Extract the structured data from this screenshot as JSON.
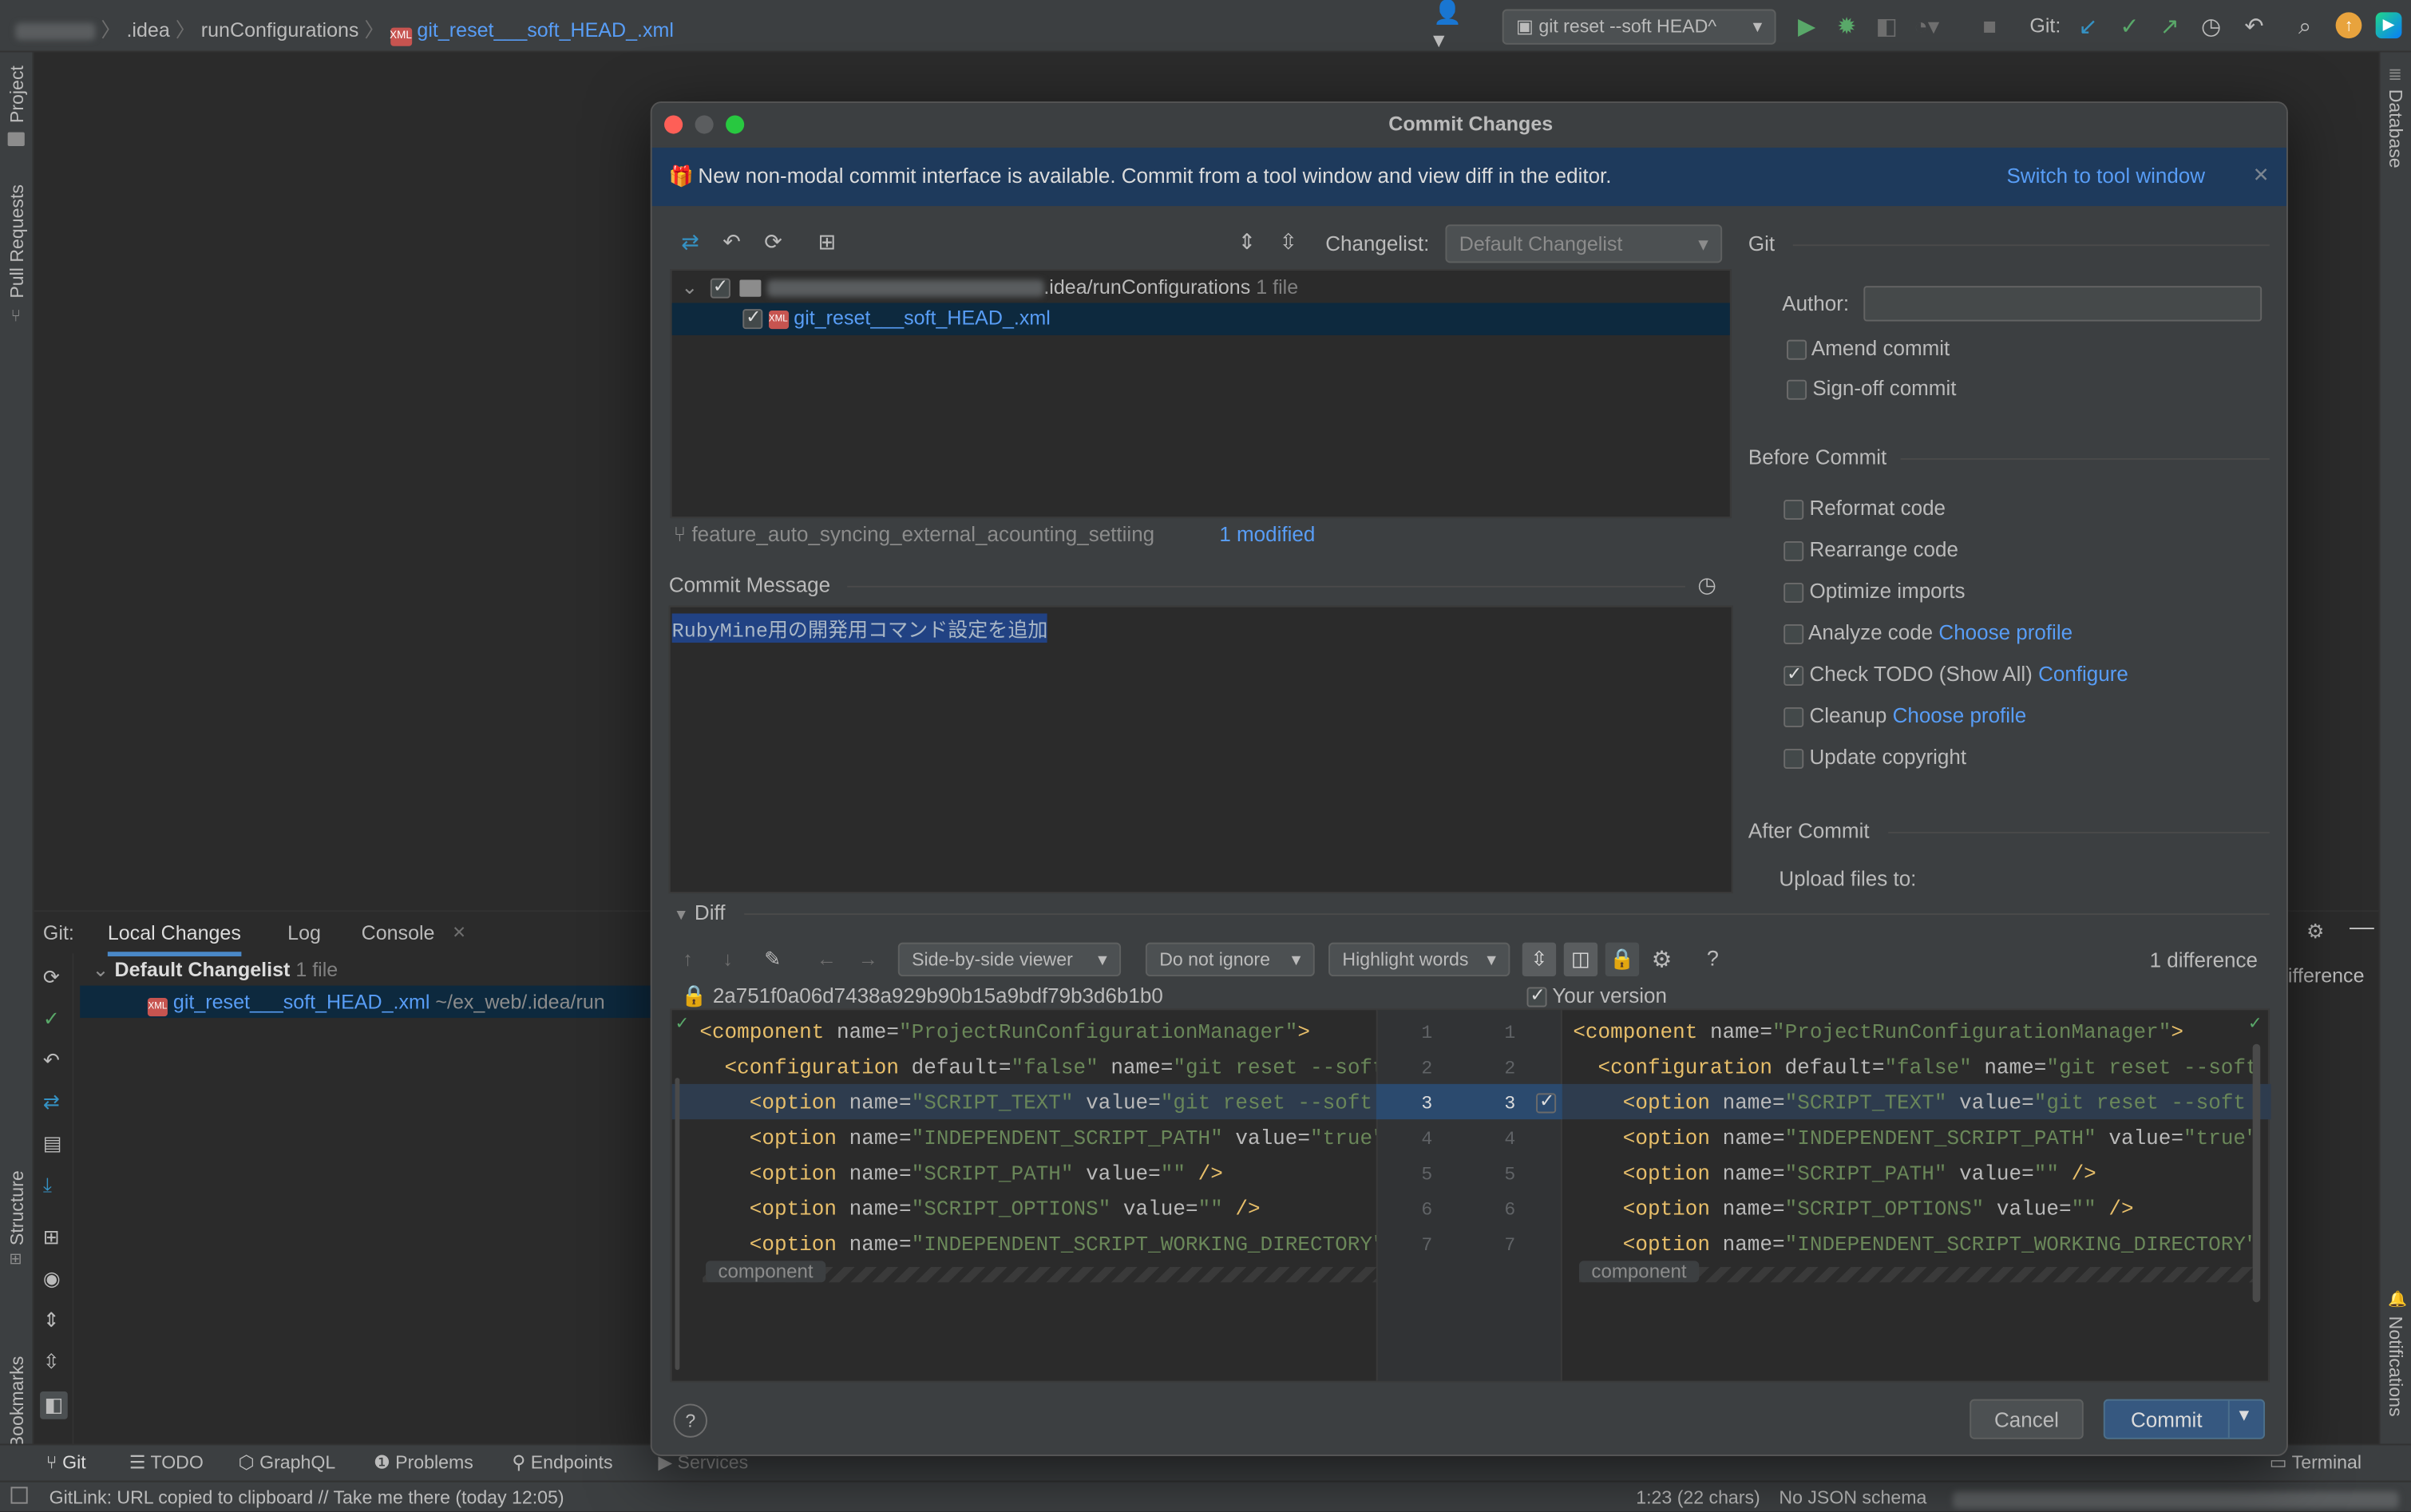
{
  "topbar": {
    "breadcrumb": [
      ".idea",
      "runConfigurations",
      "git_reset___soft_HEAD_.xml"
    ],
    "run_config": "git reset --soft HEAD^",
    "git_label": "Git:"
  },
  "left_strip": {
    "project": "Project",
    "pull_requests": "Pull Requests",
    "structure": "Structure",
    "bookmarks": "Bookmarks"
  },
  "right_strip": {
    "database": "Database",
    "notifications": "Notifications"
  },
  "bottom_tool": {
    "title": "Git:",
    "tabs": [
      "Local Changes",
      "Log",
      "Console"
    ],
    "changelist_name": "Default Changelist",
    "changelist_count": "1 file",
    "file_name": "git_reset___soft_HEAD_.xml",
    "file_path": "~/ex_web/.idea/run",
    "right_fragment": "ifference"
  },
  "bottom_bar": {
    "tabs": [
      "Git",
      "TODO",
      "GraphQL",
      "Problems",
      "Endpoints",
      "Services"
    ],
    "terminal": "Terminal"
  },
  "status_bar": {
    "message": "GitLink: URL copied to clipboard // Take me there (today 12:05)",
    "position": "1:23 (22 chars)",
    "schema": "No JSON schema"
  },
  "dialog": {
    "title": "Commit Changes",
    "banner_text": "New non-modal commit interface is available. Commit from a tool window and view diff in the editor.",
    "banner_link": "Switch to tool window",
    "changelist_label": "Changelist:",
    "changelist_value": "Default Changelist",
    "tree_folder": ".idea/runConfigurations",
    "tree_folder_count": "1 file",
    "tree_file": "git_reset___soft_HEAD_.xml",
    "branch": "feature_auto_syncing_external_acounting_settiing",
    "modified": "1 modified",
    "commit_message_label": "Commit Message",
    "commit_message": "RubyMine用の開発用コマンド設定を追加",
    "git_section": "Git",
    "author_label": "Author:",
    "author_value": "",
    "amend": "Amend commit",
    "signoff": "Sign-off commit",
    "before_commit": "Before Commit",
    "options": [
      {
        "label": "Reformat code",
        "link": "",
        "checked": false
      },
      {
        "label": "Rearrange code",
        "link": "",
        "checked": false
      },
      {
        "label": "Optimize imports",
        "link": "",
        "checked": false
      },
      {
        "label": "Analyze code",
        "link": "Choose profile",
        "checked": false
      },
      {
        "label": "Check TODO (Show All)",
        "link": "Configure",
        "checked": true
      },
      {
        "label": "Cleanup",
        "link": "Choose profile",
        "checked": false
      },
      {
        "label": "Update copyright",
        "link": "",
        "checked": false
      }
    ],
    "after_commit": "After Commit",
    "upload_label": "Upload files to:",
    "diff_label": "Diff",
    "viewer": "Side-by-side viewer",
    "ignore": "Do not ignore",
    "highlight": "Highlight words",
    "difference_count": "1 difference",
    "left_hash": "2a751f0a06d7438a929b90b15a9bdf79b3d6b1b0",
    "right_label": "Your version",
    "fold_label": "component",
    "cancel": "Cancel",
    "commit": "Commit"
  },
  "diff_lines": [
    {
      "n": "1",
      "indent": 0,
      "tag": "<component",
      "pairs": [
        [
          "name",
          "\"ProjectRunConfigurationManager\""
        ]
      ],
      "end": ">"
    },
    {
      "n": "2",
      "indent": 1,
      "tag": "<configuration",
      "pairs": [
        [
          "default",
          "\"false\""
        ],
        [
          "name",
          "\"git reset --soft"
        ]
      ],
      "end": ""
    },
    {
      "n": "3",
      "indent": 2,
      "tag": "<option",
      "pairs": [
        [
          "name",
          "\"SCRIPT_TEXT\""
        ],
        [
          "value",
          "\"git reset --soft"
        ]
      ],
      "end": ""
    },
    {
      "n": "4",
      "indent": 2,
      "tag": "<option",
      "pairs": [
        [
          "name",
          "\"INDEPENDENT_SCRIPT_PATH\""
        ],
        [
          "value",
          "\"true\""
        ]
      ],
      "end": ""
    },
    {
      "n": "5",
      "indent": 2,
      "tag": "<option",
      "pairs": [
        [
          "name",
          "\"SCRIPT_PATH\""
        ],
        [
          "value",
          "\"\""
        ]
      ],
      "end": " />"
    },
    {
      "n": "6",
      "indent": 2,
      "tag": "<option",
      "pairs": [
        [
          "name",
          "\"SCRIPT_OPTIONS\""
        ],
        [
          "value",
          "\"\""
        ]
      ],
      "end": " />"
    },
    {
      "n": "7",
      "indent": 2,
      "tag": "<option",
      "pairs": [
        [
          "name",
          "\"INDEPENDENT_SCRIPT_WORKING_DIRECTORY\""
        ]
      ],
      "end": ""
    }
  ]
}
